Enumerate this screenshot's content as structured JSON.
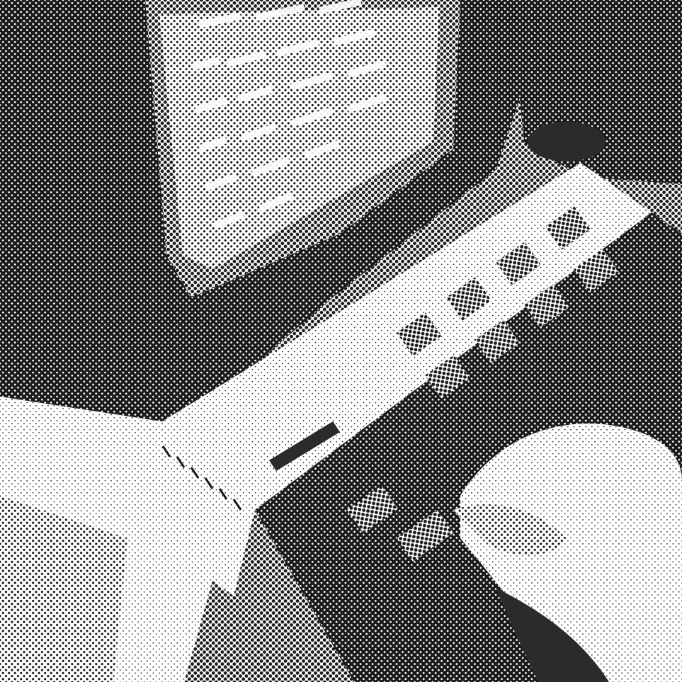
{
  "image": {
    "style": "halftone-dither",
    "subject": "crt-monitor-keyboard-hand",
    "colors": {
      "ink": "#1a1a1a",
      "paper": "#ffffff",
      "mid": "#8a8a8a",
      "dark": "#2b2b2b"
    }
  }
}
